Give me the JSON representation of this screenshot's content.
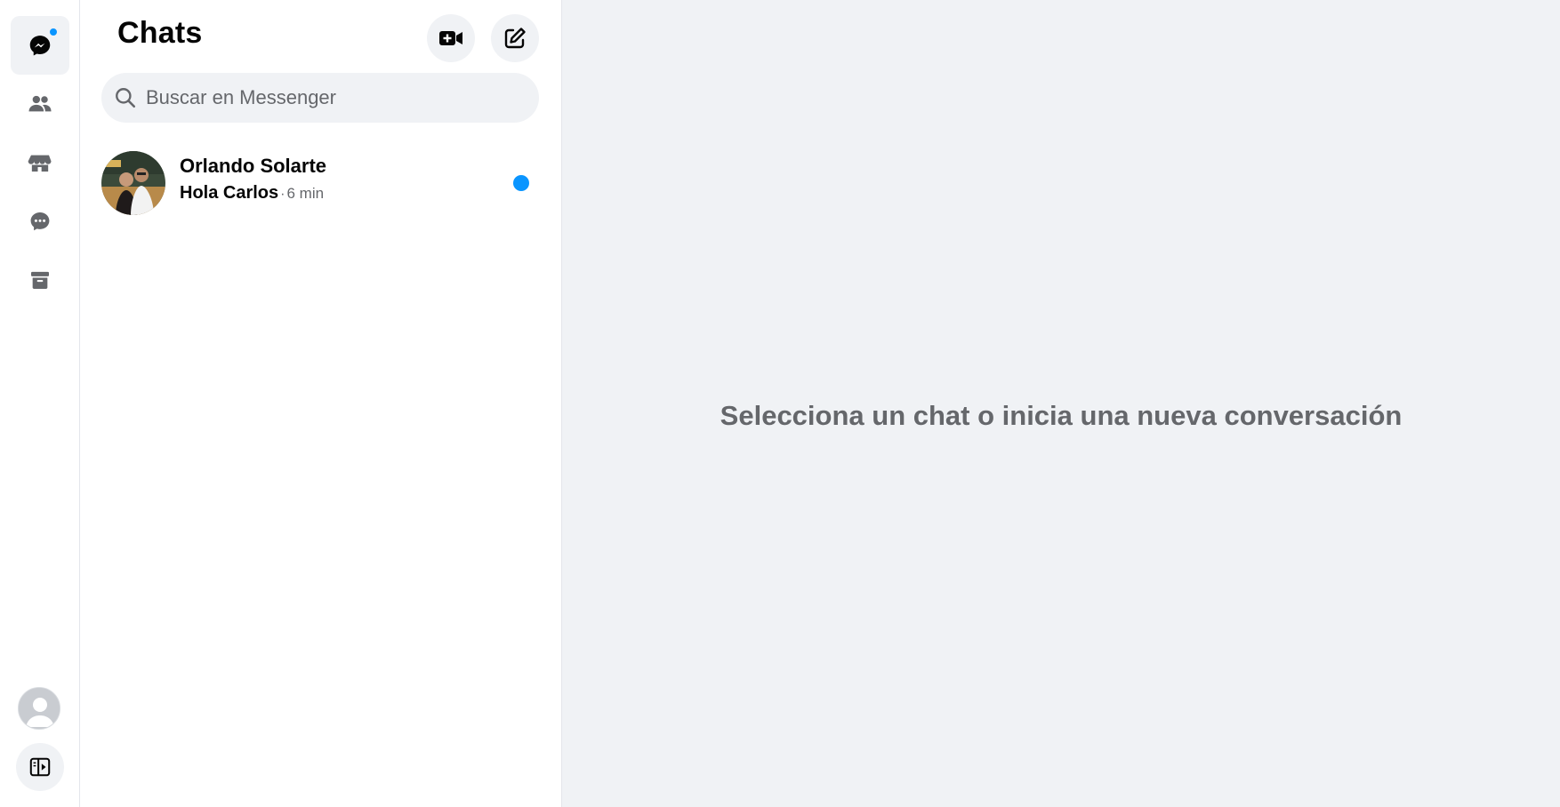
{
  "rail": {
    "items": [
      {
        "name": "chats-icon",
        "active": true,
        "has_badge": true
      },
      {
        "name": "people-icon",
        "active": false
      },
      {
        "name": "marketplace-icon",
        "active": false
      },
      {
        "name": "message-requests-icon",
        "active": false
      },
      {
        "name": "archive-icon",
        "active": false
      }
    ],
    "profile_icon": "profile-avatar",
    "collapse_icon": "sidebar-toggle-icon"
  },
  "chats_panel": {
    "title": "Chats",
    "new_room_icon": "video-plus-icon",
    "new_message_icon": "compose-icon",
    "search": {
      "placeholder": "Buscar en Messenger"
    },
    "conversations": [
      {
        "name": "Orlando Solarte",
        "last_message": "Hola Carlos",
        "separator": "·",
        "time": "6 min",
        "unread": true
      }
    ]
  },
  "main": {
    "empty_state": "Selecciona un chat o inicia una nueva conversación"
  },
  "colors": {
    "accent": "#0a95ff",
    "panel_bg": "#f0f2f5",
    "muted_text": "#65676b",
    "icon_gray": "#65676b"
  }
}
